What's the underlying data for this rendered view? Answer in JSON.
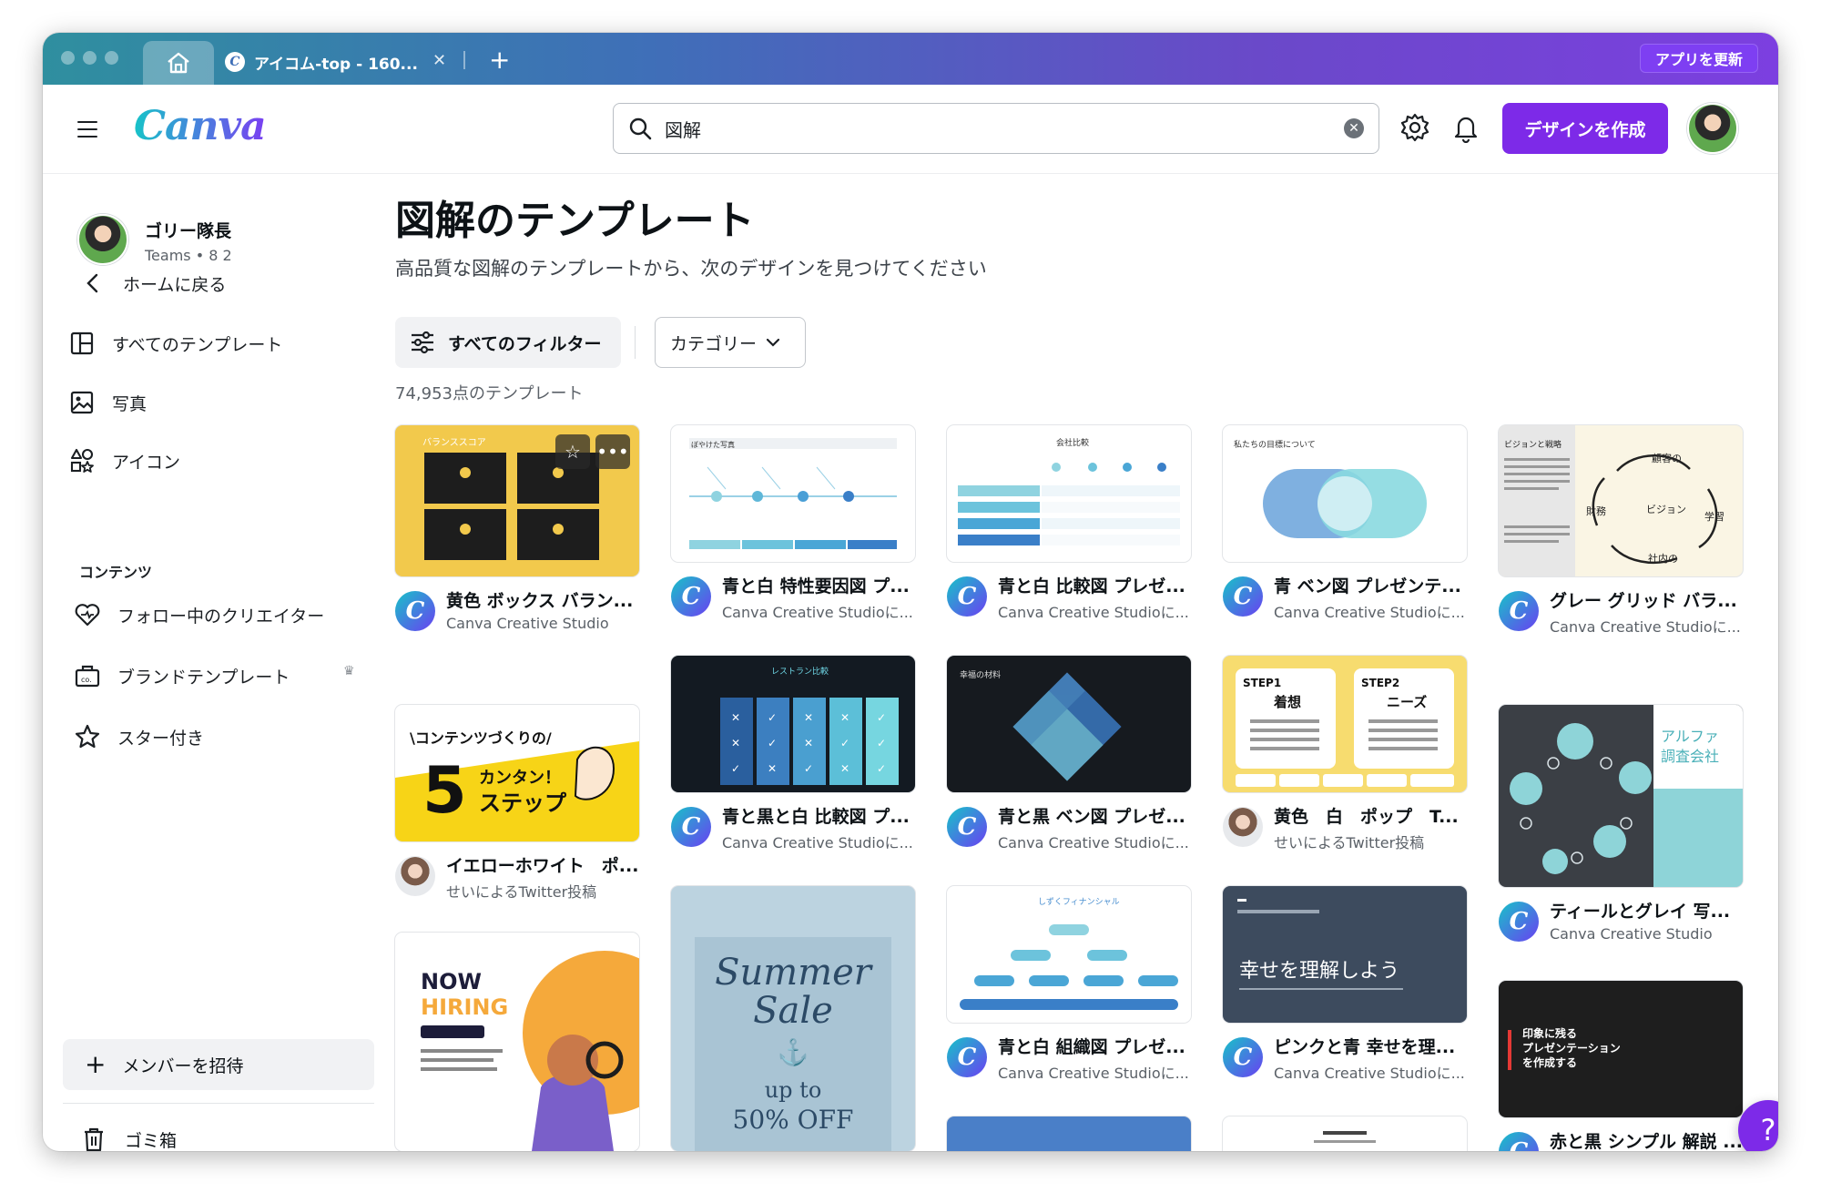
{
  "browser": {
    "tab_title": "アイコム-top - 160...",
    "update_button": "アプリを更新"
  },
  "header": {
    "logo": "Canva",
    "search_value": "図解",
    "create_button": "デザインを作成"
  },
  "sidebar": {
    "user_name": "ゴリー隊長",
    "user_sub": "Teams • 8 2",
    "back": "ホームに戻る",
    "items": [
      "すべてのテンプレート",
      "写真",
      "アイコン"
    ],
    "section_label": "コンテンツ",
    "content_items": [
      "フォロー中のクリエイター",
      "ブランドテンプレート",
      "スター付き"
    ],
    "invite": "メンバーを招待",
    "trash": "ゴミ箱"
  },
  "main": {
    "title": "図解のテンプレート",
    "subtitle": "高品質な図解のテンプレートから、次のデザインを見つけてください",
    "filter_button": "すべてのフィルター",
    "category_button": "カテゴリー",
    "count": "74,953点のテンプレート"
  },
  "cards": [
    {
      "title": "黄色 ボックス バラン...",
      "author": "Canva Creative Studio",
      "thumb_label": "バランススコア"
    },
    {
      "title": "青と白 特性要因図 プ...",
      "author": "Canva Creative Studioに...",
      "thumb_label": "ぼやけた写真"
    },
    {
      "title": "青と白 比較図 プレゼ...",
      "author": "Canva Creative Studioに...",
      "thumb_label": "会社比較"
    },
    {
      "title": "青 ベン図 プレゼンテ...",
      "author": "Canva Creative Studioに...",
      "thumb_label": "私たちの目標について"
    },
    {
      "title": "グレー グリッド バラ...",
      "author": "Canva Creative Studioに...",
      "thumb_label": "ビジョンと戦略"
    },
    {
      "title": "イエローホワイト　ポ...",
      "author": "せいによるTwitter投稿",
      "thumb_label": "コンテンツづくりの5カンタン！ステップ"
    },
    {
      "title": "青と黒と白 比較図 プ...",
      "author": "Canva Creative Studioに...",
      "thumb_label": "レストラン比較"
    },
    {
      "title": "青と黒 ベン図 プレゼ...",
      "author": "Canva Creative Studioに...",
      "thumb_label": "幸福の材料"
    },
    {
      "title": "黄色　白　ポップ　T...",
      "author": "せいによるTwitter投稿",
      "thumb_label": "STEP1 着想 / STEP2 ニーズ"
    },
    {
      "title": "ティールとグレイ 写...",
      "author": "Canva Creative Studio",
      "thumb_label": "アルファ調査会社"
    },
    {
      "title": "",
      "author": "",
      "thumb_label": "NOW HIRING"
    },
    {
      "title": "",
      "author": "",
      "thumb_label": "Summer Sale up to 50% OFF"
    },
    {
      "title": "青と白 組織図 プレゼ...",
      "author": "Canva Creative Studioに...",
      "thumb_label": "しずくフィナンシャル"
    },
    {
      "title": "ピンクと青 幸せを理...",
      "author": "Canva Creative Studioに...",
      "thumb_label": "幸せを理解しよう"
    },
    {
      "title": "赤と黒 シンプル 解説 ...",
      "author": "",
      "thumb_label": "印象に残るプレゼンテーションを作成する"
    }
  ],
  "help_button": "?",
  "colors": {
    "accent": "#7d2ae8",
    "brand_teal": "#17c3c8"
  }
}
